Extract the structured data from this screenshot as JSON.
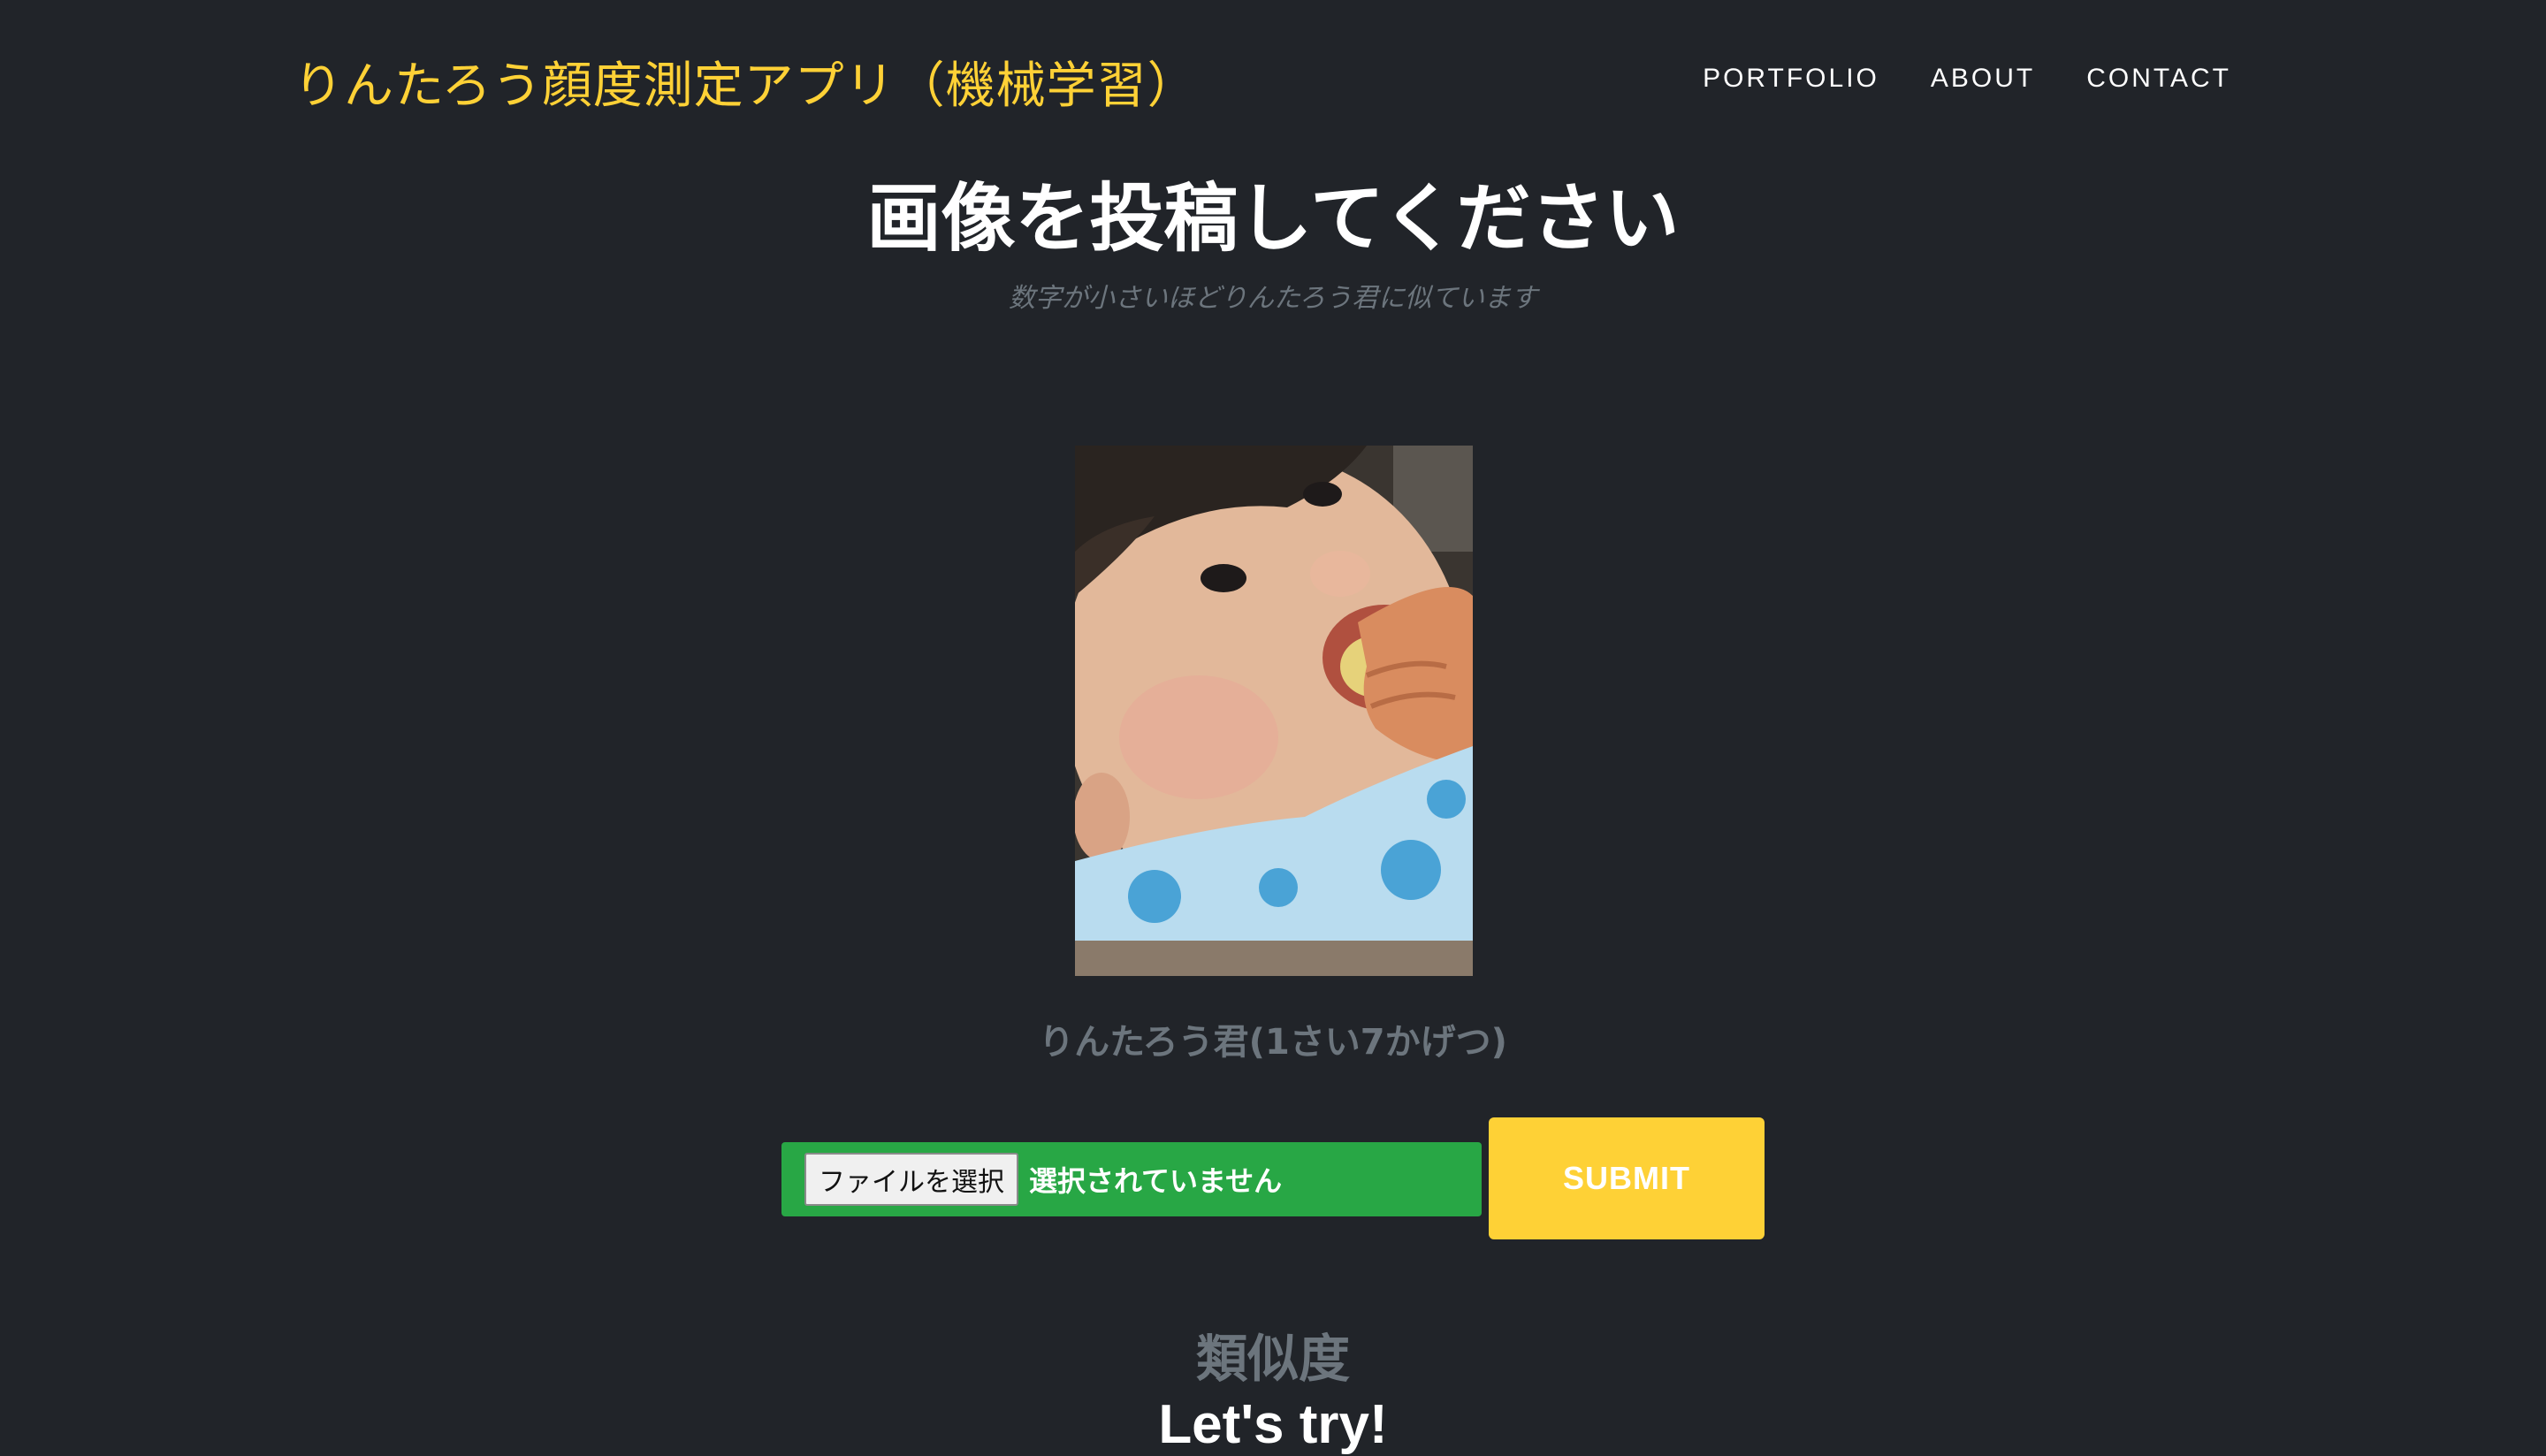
{
  "navbar": {
    "brand": "りんたろう顔度測定アプリ（機械学習）",
    "links": [
      {
        "label": "PORTFOLIO"
      },
      {
        "label": "ABOUT"
      },
      {
        "label": "CONTACT"
      }
    ]
  },
  "main": {
    "heading": "画像を投稿してください",
    "subheading": "数字が小さいほどりんたろう君に似ています",
    "photo_caption": "りんたろう君(1さい7かげつ)"
  },
  "form": {
    "file_button_label": "ファイルを選択",
    "file_status": "選択されていません",
    "submit_label": "SUBMIT"
  },
  "result": {
    "label": "類似度",
    "value": "Let's try!"
  },
  "colors": {
    "background": "#212429",
    "accent": "#fed136",
    "file_input": "#28a745",
    "muted": "#6c757d"
  }
}
